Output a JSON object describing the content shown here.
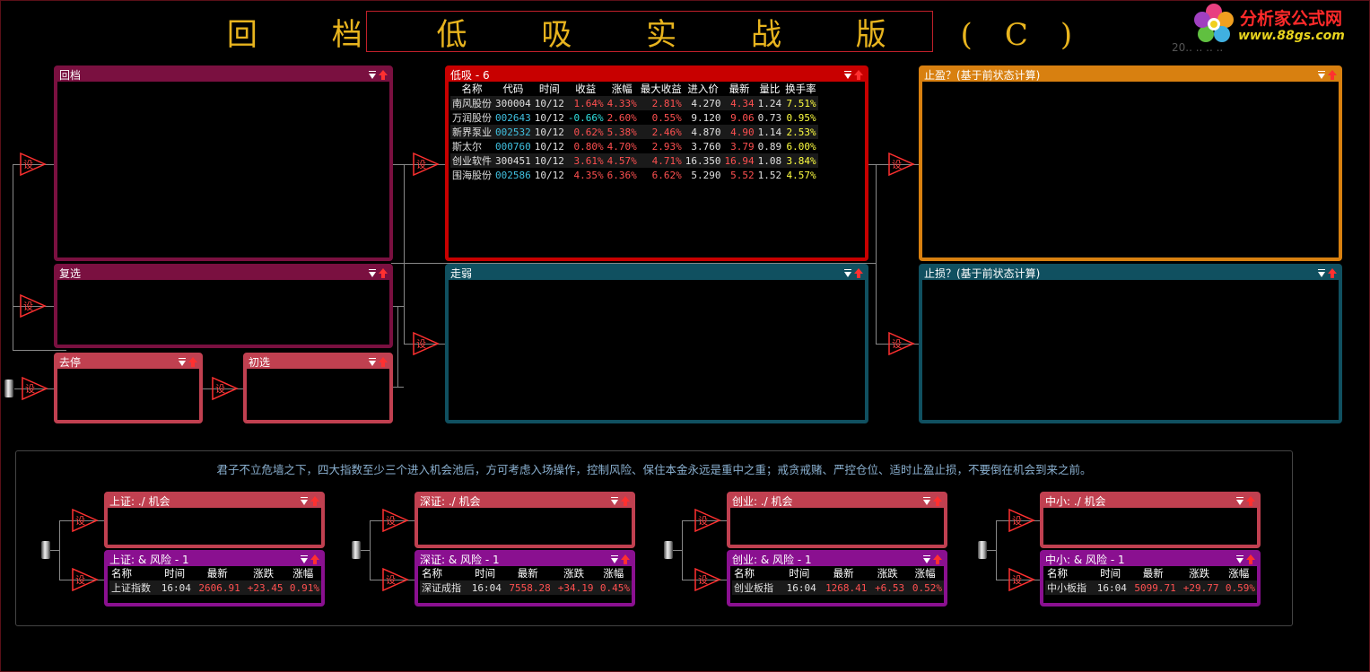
{
  "title": "回 档 低 吸 实 战 版 (C)",
  "logo": {
    "name": "分析家公式网",
    "url_text": "www.88gs.com"
  },
  "date_fragment": "20.. .. .. ..",
  "trigger_label": "设",
  "panels": {
    "huidang": {
      "title": "回档"
    },
    "fuxuan": {
      "title": "复选"
    },
    "quting": {
      "title": "去停"
    },
    "chuxuan": {
      "title": "初选"
    },
    "dixi": {
      "title": "低吸 - 6",
      "columns": [
        "名称",
        "代码",
        "时间",
        "收益",
        "涨幅",
        "最大收益",
        "进入价",
        "最新",
        "量比",
        "换手率"
      ],
      "rows": [
        {
          "name": "南风股份",
          "code": "300004",
          "time": "10/12",
          "gain": "1.64%",
          "chg": "4.33%",
          "maxgain": "2.81%",
          "entry": "4.270",
          "last": "4.34",
          "vol": "1.24",
          "turn": "7.51%"
        },
        {
          "name": "万润股份",
          "code": "002643",
          "time": "10/12",
          "gain": "-0.66%",
          "chg": "2.60%",
          "maxgain": "0.55%",
          "entry": "9.120",
          "last": "9.06",
          "vol": "0.73",
          "turn": "0.95%"
        },
        {
          "name": "新界泵业",
          "code": "002532",
          "time": "10/12",
          "gain": "0.62%",
          "chg": "5.38%",
          "maxgain": "2.46%",
          "entry": "4.870",
          "last": "4.90",
          "vol": "1.14",
          "turn": "2.53%"
        },
        {
          "name": "斯太尔",
          "code": "000760",
          "time": "10/12",
          "gain": "0.80%",
          "chg": "4.70%",
          "maxgain": "2.93%",
          "entry": "3.760",
          "last": "3.79",
          "vol": "0.89",
          "turn": "6.00%"
        },
        {
          "name": "创业软件",
          "code": "300451",
          "time": "10/12",
          "gain": "3.61%",
          "chg": "4.57%",
          "maxgain": "4.71%",
          "entry": "16.350",
          "last": "16.94",
          "vol": "1.08",
          "turn": "3.84%"
        },
        {
          "name": "围海股份",
          "code": "002586",
          "time": "10/12",
          "gain": "4.35%",
          "chg": "6.36%",
          "maxgain": "6.62%",
          "entry": "5.290",
          "last": "5.52",
          "vol": "1.52",
          "turn": "4.57%"
        }
      ]
    },
    "zouruo": {
      "title": "走弱"
    },
    "zhiying": {
      "title": "止盈？(基于前状态计算)"
    },
    "zhisun": {
      "title": "止损？(基于前状态计算)"
    }
  },
  "motto": "君子不立危墙之下，四大指数至少三个进入机会池后，方可考虑入场操作，控制风险、保住本金永远是重中之重；戒贪戒赌、严控仓位、适时止盈止损，不要倒在机会到来之前。",
  "index_columns": [
    "名称",
    "时间",
    "最新",
    "涨跌",
    "涨幅"
  ],
  "indices": [
    {
      "chance_title": "上证: ./ 机会",
      "risk_title": "上证: & 风险 - 1",
      "name": "上证指数",
      "time": "16:04",
      "last": "2606.91",
      "chg": "+23.45",
      "pct": "0.91%"
    },
    {
      "chance_title": "深证: ./ 机会",
      "risk_title": "深证: & 风险 - 1",
      "name": "深证成指",
      "time": "16:04",
      "last": "7558.28",
      "chg": "+34.19",
      "pct": "0.45%"
    },
    {
      "chance_title": "创业: ./ 机会",
      "risk_title": "创业: & 风险 - 1",
      "name": "创业板指",
      "time": "16:04",
      "last": "1268.41",
      "chg": "+6.53",
      "pct": "0.52%"
    },
    {
      "chance_title": "中小: ./ 机会",
      "risk_title": "中小: & 风险 - 1",
      "name": "中小板指",
      "time": "16:04",
      "last": "5099.71",
      "chg": "+29.77",
      "pct": "0.59%"
    }
  ]
}
